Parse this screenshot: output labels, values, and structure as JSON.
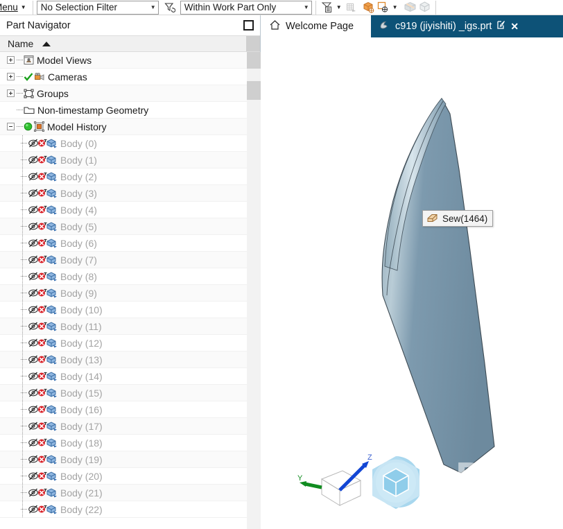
{
  "app": {
    "accent_tab_color": "#0d5277",
    "body_color": "#7b98ab",
    "tree_disabled_text": "#a3a3a3"
  },
  "toolbar": {
    "menu_label": "Menu",
    "selection_filter": {
      "value": "No Selection Filter",
      "arrow": "▼",
      "name": "selection-filter-dropdown"
    },
    "filter_reset_icon": "filter-reset-icon",
    "scope": {
      "value": "Within Work Part Only",
      "arrow": "▼",
      "name": "scope-dropdown"
    },
    "buttons": [
      {
        "name": "selection-settings-icon",
        "label": ""
      },
      {
        "name": "face-selection-icon",
        "label": ""
      },
      {
        "name": "select-body-icon",
        "label": ""
      },
      {
        "name": "select-feature-icon",
        "label": ""
      },
      {
        "name": "shaded-body-icon",
        "label": ""
      },
      {
        "name": "wireframe-body-icon",
        "label": ""
      }
    ]
  },
  "navigator": {
    "title": "Part Navigator",
    "dock_button": "dock-button",
    "column_header": "Name",
    "sort_direction": "ascending",
    "tree": [
      {
        "label": "Model Views",
        "type": "group",
        "expander": "plus",
        "icon": "model-views-icon",
        "indent": 0
      },
      {
        "label": "Cameras",
        "type": "group",
        "expander": "plus",
        "icon": "cameras-icon",
        "indent": 0,
        "check": true
      },
      {
        "label": "Groups",
        "type": "group",
        "expander": "plus",
        "icon": "groups-icon",
        "indent": 0
      },
      {
        "label": "Non-timestamp Geometry",
        "type": "group",
        "expander": "none",
        "icon": "folder-icon",
        "indent": 0
      },
      {
        "label": "Model History",
        "type": "group",
        "expander": "minus",
        "icon": "model-history-icon",
        "indent": 0,
        "dot": true
      },
      {
        "label": "Body (0)",
        "type": "body",
        "indent": 1
      },
      {
        "label": "Body (1)",
        "type": "body",
        "indent": 1
      },
      {
        "label": "Body (2)",
        "type": "body",
        "indent": 1
      },
      {
        "label": "Body (3)",
        "type": "body",
        "indent": 1
      },
      {
        "label": "Body (4)",
        "type": "body",
        "indent": 1
      },
      {
        "label": "Body (5)",
        "type": "body",
        "indent": 1
      },
      {
        "label": "Body (6)",
        "type": "body",
        "indent": 1
      },
      {
        "label": "Body (7)",
        "type": "body",
        "indent": 1
      },
      {
        "label": "Body (8)",
        "type": "body",
        "indent": 1
      },
      {
        "label": "Body (9)",
        "type": "body",
        "indent": 1
      },
      {
        "label": "Body (10)",
        "type": "body",
        "indent": 1
      },
      {
        "label": "Body (11)",
        "type": "body",
        "indent": 1
      },
      {
        "label": "Body (12)",
        "type": "body",
        "indent": 1
      },
      {
        "label": "Body (13)",
        "type": "body",
        "indent": 1
      },
      {
        "label": "Body (14)",
        "type": "body",
        "indent": 1
      },
      {
        "label": "Body (15)",
        "type": "body",
        "indent": 1
      },
      {
        "label": "Body (16)",
        "type": "body",
        "indent": 1
      },
      {
        "label": "Body (17)",
        "type": "body",
        "indent": 1
      },
      {
        "label": "Body (18)",
        "type": "body",
        "indent": 1
      },
      {
        "label": "Body (19)",
        "type": "body",
        "indent": 1
      },
      {
        "label": "Body (20)",
        "type": "body",
        "indent": 1
      },
      {
        "label": "Body (21)",
        "type": "body",
        "indent": 1
      },
      {
        "label": "Body (22)",
        "type": "body",
        "indent": 1
      }
    ],
    "scrollbar": {
      "name": "tree-vertical-scrollbar",
      "up_arrow": "▲"
    }
  },
  "tabs": [
    {
      "label": "Welcome Page",
      "icon": "home-icon",
      "active": false,
      "name": "tab-welcome-page"
    },
    {
      "label": "c919  (jiyishiti)  _igs.prt",
      "icon": "part-file-icon",
      "active": true,
      "modified_icon": "edit-icon",
      "close_icon": "✕",
      "name": "tab-part-file"
    }
  ],
  "viewport": {
    "tooltip": {
      "label": "Sew(1464)",
      "icon": "sew-icon"
    },
    "watermark": "D#",
    "triad": {
      "axis_y": "Y",
      "axis_z": "Z"
    },
    "viewcube": "view-cube-navigator"
  }
}
